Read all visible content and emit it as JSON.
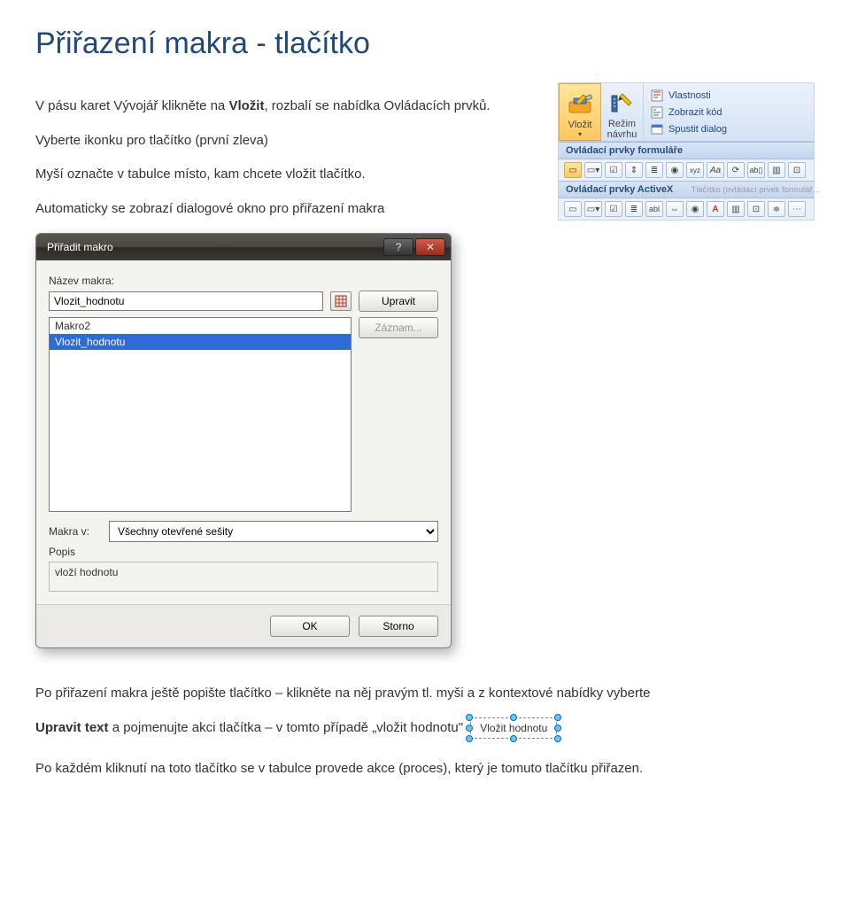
{
  "title": "Přiřazení makra - tlačítko",
  "p1_a": "V pásu karet Vývojář klikněte na ",
  "p1_b": "Vložit",
  "p1_c": ", rozbalí se nabídka Ovládacích prvků.",
  "p2": "Vyberte ikonku pro tlačítko (první zleva)",
  "p3": "Myší označte v tabulce místo, kam chcete vložit tlačítko.",
  "p4": "Automaticky se zobrazí dialogové okno pro přiřazení makra",
  "ribbon": {
    "insert": "Vložit",
    "design": "Režim\nnávrhu",
    "props": "Vlastnosti",
    "viewcode": "Zobrazit kód",
    "rundlg": "Spustit dialog",
    "group1": "Ovládací prvky formuláře",
    "group2": "Ovládací prvky ActiveX",
    "tooltip": "Tlačítko (ovládací prvek formulář…"
  },
  "dialog": {
    "title": "Přiřadit makro",
    "name_label": "Název makra:",
    "name_value": "Vlozit_hodnotu",
    "edit_btn": "Upravit",
    "record_btn": "Záznam...",
    "list": [
      "Makro2",
      "Vlozit_hodnotu"
    ],
    "list_selected": 1,
    "macros_in_label": "Makra v:",
    "macros_in_value": "Všechny otevřené sešity",
    "desc_label": "Popis",
    "desc_value": "vloží hodnotu",
    "ok": "OK",
    "cancel": "Storno"
  },
  "p5_a": "Po přiřazení makra ještě popište tlačítko – klikněte na něj pravým tl. myši a z kontextové nabídky vyberte",
  "p5_b": "Upravit text",
  "p5_c": " a pojmenujte akci tlačítka – v tomto případě „vložit hodnotu\"",
  "edit_button_caption": "Vložit hodnotu",
  "p6": "Po každém kliknutí na toto tlačítko se v tabulce provede akce (proces), který je tomuto tlačítku přiřazen."
}
